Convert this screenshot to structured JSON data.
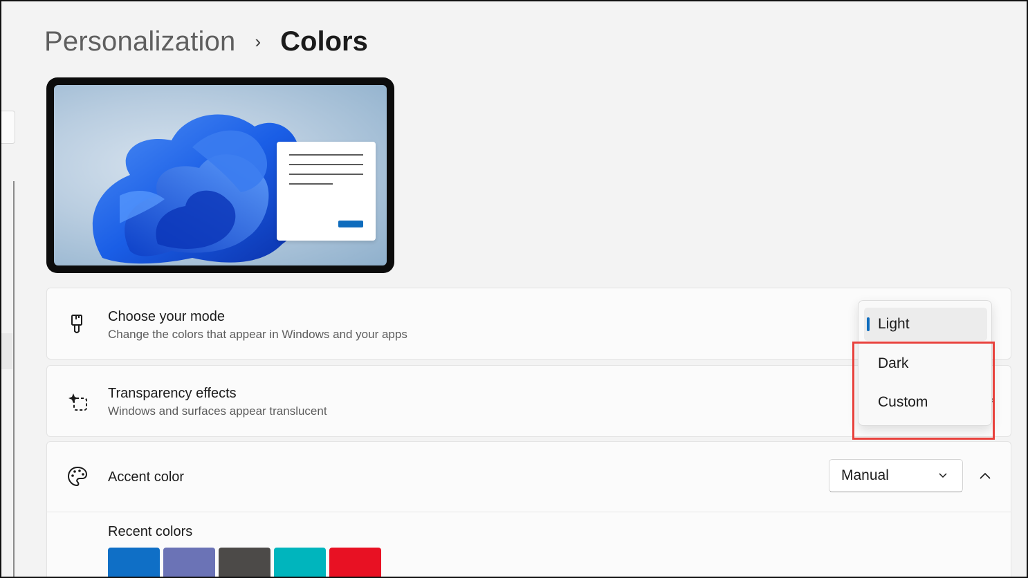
{
  "breadcrumb": {
    "parent": "Personalization",
    "separator": "›",
    "current": "Colors"
  },
  "mode_card": {
    "title": "Choose your mode",
    "description": "Change the colors that appear in Windows and your apps",
    "icon": "paintbrush-icon",
    "menu": {
      "selected": "Light",
      "options": [
        "Light",
        "Dark",
        "Custom"
      ]
    }
  },
  "transparency_card": {
    "title": "Transparency effects",
    "description": "Windows and surfaces appear translucent",
    "icon": "transparency-icon"
  },
  "accent_card": {
    "title": "Accent color",
    "icon": "palette-icon",
    "select_value": "Manual",
    "recent_label": "Recent colors",
    "recent_colors": [
      "#0f6fc6",
      "#6b73b6",
      "#4c4a48",
      "#00b5bd",
      "#e81123"
    ]
  },
  "colors": {
    "accent": "#0f6cbd",
    "highlight_box": "#e8413c"
  }
}
